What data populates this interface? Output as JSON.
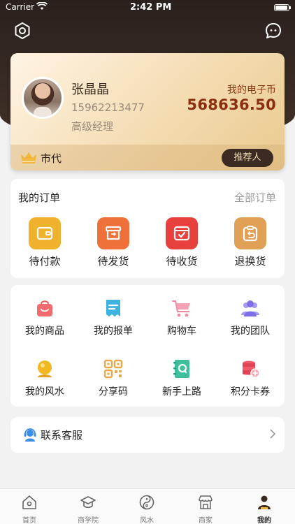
{
  "status_bar": {
    "carrier": "Carrier",
    "time": "2:42 PM"
  },
  "profile": {
    "name": "张晶晶",
    "phone": "15962213477",
    "role": "高级经理",
    "coin_label": "我的电子币",
    "coin_value": "568636.50",
    "level": "市代",
    "referrer_button": "推荐人"
  },
  "orders": {
    "title": "我的订单",
    "all_link": "全部订单",
    "items": [
      {
        "label": "待付款",
        "icon": "wallet-icon",
        "color": "#f0b22c"
      },
      {
        "label": "待发货",
        "icon": "box-icon",
        "color": "#f0703a"
      },
      {
        "label": "待收货",
        "icon": "receive-icon",
        "color": "#e8403c"
      },
      {
        "label": "退换货",
        "icon": "return-icon",
        "color": "#e0a055"
      }
    ]
  },
  "tools": {
    "items": [
      {
        "label": "我的商品",
        "icon": "shopping-bag-icon"
      },
      {
        "label": "我的报单",
        "icon": "receipt-icon"
      },
      {
        "label": "购物车",
        "icon": "cart-icon"
      },
      {
        "label": "我的团队",
        "icon": "team-icon"
      },
      {
        "label": "我的风水",
        "icon": "crystal-ball-icon"
      },
      {
        "label": "分享码",
        "icon": "qr-code-icon"
      },
      {
        "label": "新手上路",
        "icon": "guide-book-icon"
      },
      {
        "label": "积分卡券",
        "icon": "coupon-icon"
      }
    ]
  },
  "service": {
    "label": "联系客服"
  },
  "tabbar": {
    "items": [
      {
        "label": "首页",
        "icon": "home-icon"
      },
      {
        "label": "商学院",
        "icon": "graduation-cap-icon"
      },
      {
        "label": "风水",
        "icon": "yin-yang-icon"
      },
      {
        "label": "商家",
        "icon": "store-icon"
      },
      {
        "label": "我的",
        "icon": "user-icon"
      }
    ],
    "active_index": 4
  }
}
